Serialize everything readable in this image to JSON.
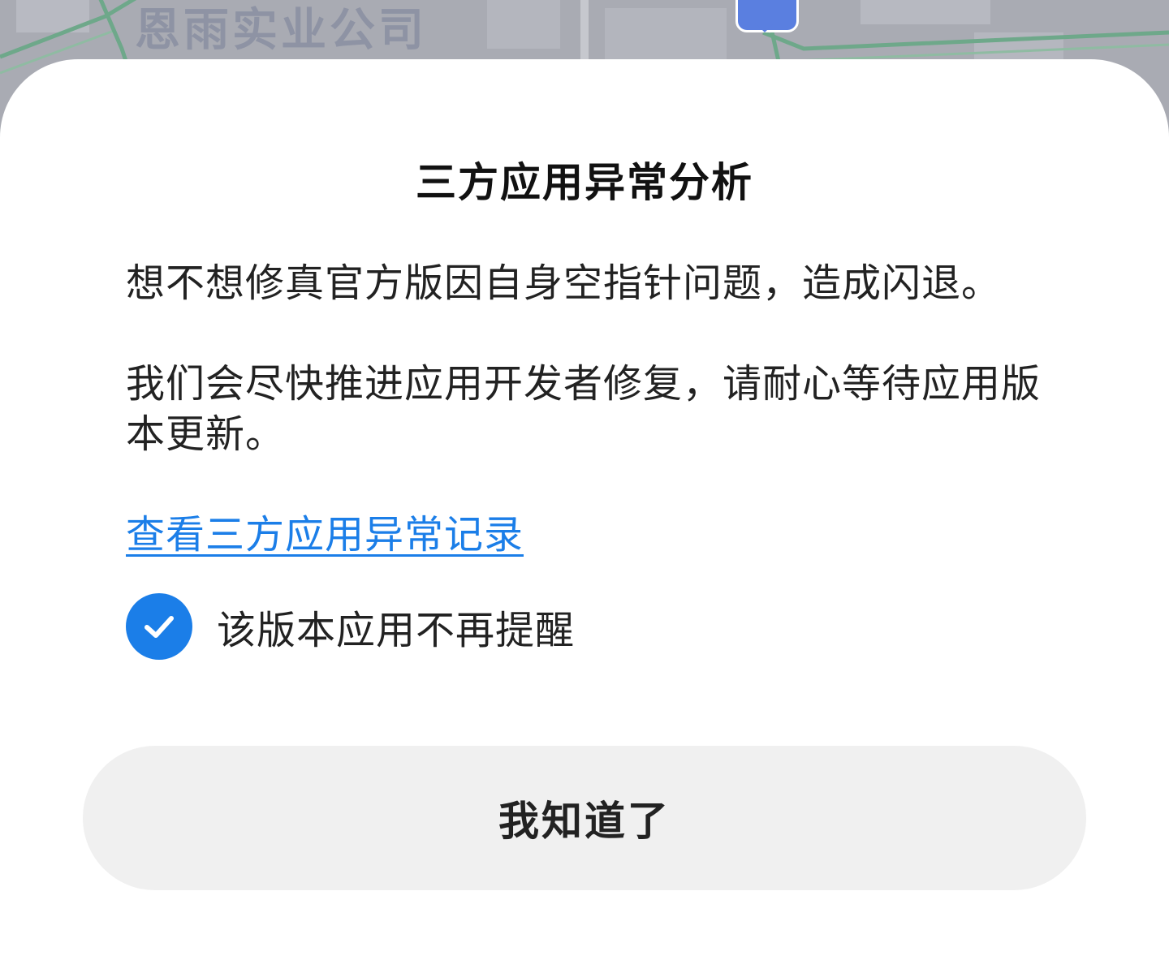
{
  "background": {
    "map_label": "恩雨实业公司"
  },
  "dialog": {
    "title": "三方应用异常分析",
    "message_line1": "想不想修真官方版因自身空指针问题，造成闪退。",
    "message_line2": "我们会尽快推进应用开发者修复，请耐心等待应用版本更新。",
    "link_text": "查看三方应用异常记录",
    "checkbox": {
      "label": "该版本应用不再提醒",
      "checked": true
    },
    "confirm_button": "我知道了"
  },
  "colors": {
    "accent": "#1b7ee8",
    "sheet": "#ffffff",
    "button_bg": "#f0f0f0",
    "map_bg": "#a9abb3"
  }
}
